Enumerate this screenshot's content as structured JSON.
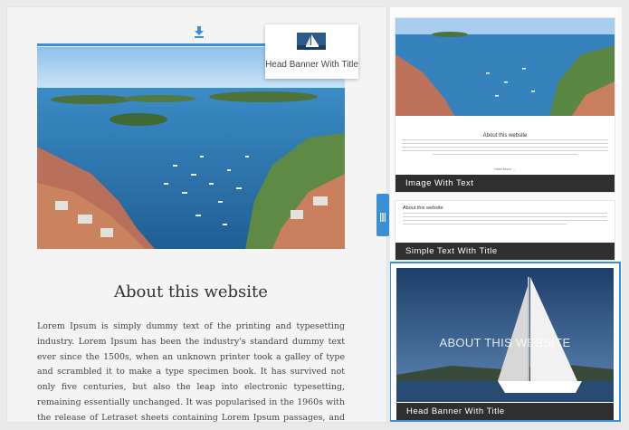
{
  "canvas": {
    "about_title": "About this website",
    "about_body": "Lorem Ipsum is simply dummy text of the printing and typesetting industry. Lorem Ipsum has been the industry's standard dummy text ever since the 1500s, when an unknown printer took a galley of type and scrambled it to make a type specimen book. It has survived not only five centuries, but also the leap into electronic typesetting, remaining essentially unchanged. It was popularised in the 1960s with the release of Letraset sheets containing Lorem Ipsum passages, and more recently with desktop publishing software like Aldus PageMaker including versions of Lorem"
  },
  "drag_preview": {
    "label": "Head Banner With Title"
  },
  "panel": {
    "cards": [
      {
        "caption": "Image With Text",
        "title": "About this website",
        "more": "View More →"
      },
      {
        "caption": "Simple Text With Title",
        "title": "About this website"
      },
      {
        "caption": "Head Banner With Title",
        "banner_title": "ABOUT THIS WEBSITE"
      }
    ]
  },
  "colors": {
    "accent": "#3b8fd6",
    "caption_bg": "#2f2f2f"
  },
  "icons": {
    "drag_handle": "download-arrow-icon",
    "splitter": "grip-bars-icon"
  }
}
